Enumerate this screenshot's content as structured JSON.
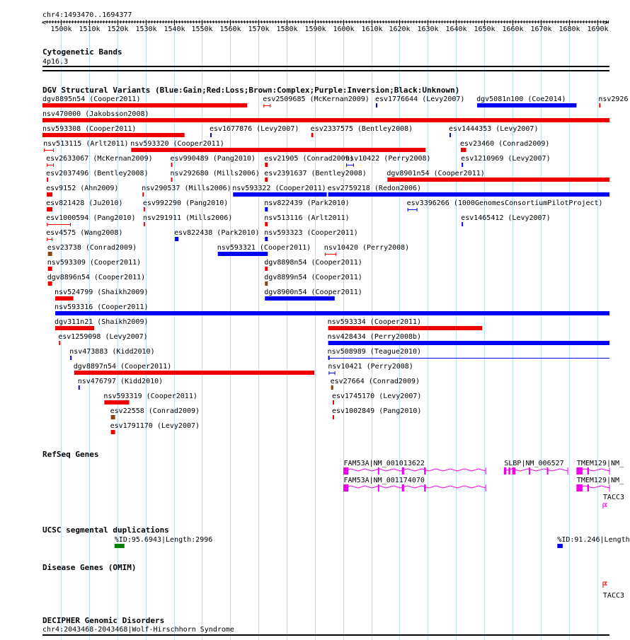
{
  "ruler": {
    "region": "chr4:1493470..1694377",
    "start": 1493470,
    "end": 1694377,
    "ticks": [
      "1500k",
      "1510k",
      "1520k",
      "1530k",
      "1540k",
      "1550k",
      "1560k",
      "1570k",
      "1580k",
      "1590k",
      "1600k",
      "1610k",
      "1620k",
      "1630k",
      "1640k",
      "1650k",
      "1660k",
      "1670k",
      "1680k",
      "1690k"
    ]
  },
  "colors": {
    "gain": "#0000ee",
    "loss": "#ee0000",
    "complex": "#8b4513",
    "gene": "#ee00ee",
    "segdup": "#008000",
    "grid": "#bfe2f2"
  },
  "cytoband": {
    "title": "Cytogenetic Bands",
    "band": "4p16.3"
  },
  "dgv": {
    "title": "DGV Structural Variants (Blue:Gain;Red:Loss;Brown:Complex;Purple:Inversion;Black:Unknown)",
    "variants": [
      {
        "label": "dgv8895n54 (Cooper2011)",
        "start": 1493470,
        "end": 1566000,
        "type": "loss",
        "row": 0
      },
      {
        "label": "esv2509685 (McKernan2009)",
        "start": 1571800,
        "end": 1574300,
        "type": "loss",
        "row": 0,
        "style": "span"
      },
      {
        "label": "esv1776644 (Levy2007)",
        "start": 1611600,
        "end": 1612100,
        "type": "gain",
        "row": 0
      },
      {
        "label": "dgv5081n100 (Coe2014)",
        "start": 1647500,
        "end": 1682700,
        "type": "gain",
        "row": 0
      },
      {
        "label": "nsv2926",
        "start": 1690700,
        "end": 1691200,
        "type": "loss",
        "row": 0
      },
      {
        "label": "nsv470000 (Jakobsson2008)",
        "start": 1493470,
        "end": 1694377,
        "type": "loss",
        "row": 1
      },
      {
        "label": "nsv593308 (Cooper2011)",
        "start": 1493470,
        "end": 1543800,
        "type": "loss",
        "row": 2
      },
      {
        "label": "esv1677876 (Levy2007)",
        "start": 1552900,
        "end": 1553400,
        "type": "gain",
        "row": 2
      },
      {
        "label": "esv2337575 (Bentley2008)",
        "start": 1588700,
        "end": 1589400,
        "type": "loss",
        "row": 2
      },
      {
        "label": "esv1444353 (Levy2007)",
        "start": 1637700,
        "end": 1638200,
        "type": "gain",
        "row": 2
      },
      {
        "label": "nsv513115 (Arlt2011)",
        "start": 1494000,
        "end": 1497500,
        "type": "loss",
        "row": 3,
        "style": "span"
      },
      {
        "label": "nsv593320 (Cooper2011)",
        "start": 1524900,
        "end": 1629200,
        "type": "loss",
        "row": 3
      },
      {
        "label": "esv23460 (Conrad2009)",
        "start": 1641700,
        "end": 1643600,
        "type": "loss",
        "row": 3
      },
      {
        "label": "esv2633067 (McKernan2009)",
        "start": 1495000,
        "end": 1497500,
        "type": "loss",
        "row": 4,
        "style": "span"
      },
      {
        "label": "esv990489 (Pang2010)",
        "start": 1539000,
        "end": 1539500,
        "type": "loss",
        "row": 4
      },
      {
        "label": "esv21905 (Conrad2009)",
        "start": 1572300,
        "end": 1573300,
        "type": "loss",
        "row": 4
      },
      {
        "label": "nsv10422 (Perry2008)",
        "start": 1601100,
        "end": 1603800,
        "type": "gain",
        "row": 4,
        "style": "span"
      },
      {
        "label": "esv1210969 (Levy2007)",
        "start": 1642000,
        "end": 1642500,
        "type": "gain",
        "row": 4
      },
      {
        "label": "esv2037496 (Bentley2008)",
        "start": 1495000,
        "end": 1495500,
        "type": "loss",
        "row": 5
      },
      {
        "label": "nsv292680 (Mills2006)",
        "start": 1539000,
        "end": 1539500,
        "type": "loss",
        "row": 5
      },
      {
        "label": "esv2391637 (Bentley2008)",
        "start": 1572300,
        "end": 1573300,
        "type": "loss",
        "row": 5
      },
      {
        "label": "dgv8901n54 (Cooper2011)",
        "start": 1615700,
        "end": 1694377,
        "type": "loss",
        "row": 5
      },
      {
        "label": "esv9152 (Ahn2009)",
        "start": 1495000,
        "end": 1497000,
        "type": "loss",
        "row": 6
      },
      {
        "label": "nsv290537 (Mills2006)",
        "start": 1528900,
        "end": 1529400,
        "type": "loss",
        "row": 6
      },
      {
        "label": "nsv593322 (Cooper2011)",
        "start": 1561000,
        "end": 1594200,
        "type": "gain",
        "row": 6
      },
      {
        "label": "esv2759218 (Redon2006)",
        "start": 1594700,
        "end": 1694377,
        "type": "gain",
        "row": 6
      },
      {
        "label": "esv821428 (Ju2010)",
        "start": 1495000,
        "end": 1497000,
        "type": "loss",
        "row": 7
      },
      {
        "label": "esv992290 (Pang2010)",
        "start": 1529300,
        "end": 1529800,
        "type": "loss",
        "row": 7
      },
      {
        "label": "nsv822439 (Park2010)",
        "start": 1572300,
        "end": 1573300,
        "type": "gain",
        "row": 7
      },
      {
        "label": "esv3396266 (1000GenomesConsortiumPilotProject)",
        "start": 1622800,
        "end": 1626300,
        "type": "gain",
        "row": 7,
        "style": "span"
      },
      {
        "label": "esv1000594 (Pang2010)",
        "start": 1495000,
        "end": 1503500,
        "type": "loss",
        "row": 8,
        "style": "span"
      },
      {
        "label": "nsv291911 (Mills2006)",
        "start": 1529300,
        "end": 1529800,
        "type": "loss",
        "row": 8
      },
      {
        "label": "nsv513116 (Arlt2011)",
        "start": 1572300,
        "end": 1573300,
        "type": "loss",
        "row": 8
      },
      {
        "label": "esv1465412 (Levy2007)",
        "start": 1642000,
        "end": 1642500,
        "type": "gain",
        "row": 8
      },
      {
        "label": "esv4575 (Wang2008)",
        "start": 1495000,
        "end": 1497000,
        "type": "loss",
        "row": 9,
        "style": "span"
      },
      {
        "label": "esv822438 (Park2010)",
        "start": 1540400,
        "end": 1541700,
        "type": "gain",
        "row": 9
      },
      {
        "label": "nsv593323 (Cooper2011)",
        "start": 1572300,
        "end": 1573300,
        "type": "gain",
        "row": 9
      },
      {
        "label": "esv23738 (Conrad2009)",
        "start": 1495400,
        "end": 1496900,
        "type": "complex",
        "row": 10
      },
      {
        "label": "nsv593321 (Cooper2011)",
        "start": 1555600,
        "end": 1573300,
        "type": "gain",
        "row": 10
      },
      {
        "label": "nsv10420 (Perry2008)",
        "start": 1593500,
        "end": 1597600,
        "type": "loss",
        "row": 10,
        "style": "span"
      },
      {
        "label": "nsv593309 (Cooper2011)",
        "start": 1495400,
        "end": 1496900,
        "type": "loss",
        "row": 11
      },
      {
        "label": "dgv8898n54 (Cooper2011)",
        "start": 1572300,
        "end": 1573300,
        "type": "loss",
        "row": 11
      },
      {
        "label": "dgv8896n54 (Cooper2011)",
        "start": 1495400,
        "end": 1496900,
        "type": "loss",
        "row": 12
      },
      {
        "label": "dgv8899n54 (Cooper2011)",
        "start": 1572300,
        "end": 1573300,
        "type": "complex",
        "row": 12
      },
      {
        "label": "nsv524799 (Shaikh2009)",
        "start": 1498000,
        "end": 1504400,
        "type": "loss",
        "row": 13
      },
      {
        "label": "dgv8900n54 (Cooper2011)",
        "start": 1572300,
        "end": 1597000,
        "type": "gain",
        "row": 13
      },
      {
        "label": "nsv593316 (Cooper2011)",
        "start": 1498000,
        "end": 1694377,
        "type": "gain",
        "row": 14
      },
      {
        "label": "dgv311n21 (Shaikh2009)",
        "start": 1498000,
        "end": 1511800,
        "type": "loss",
        "row": 15
      },
      {
        "label": "nsv593334 (Cooper2011)",
        "start": 1594700,
        "end": 1649300,
        "type": "loss",
        "row": 15
      },
      {
        "label": "esv1259098 (Levy2007)",
        "start": 1499300,
        "end": 1499800,
        "type": "loss",
        "row": 16
      },
      {
        "label": "nsv428434 (Perry2008b)",
        "start": 1594700,
        "end": 1694377,
        "type": "gain",
        "row": 16
      },
      {
        "label": "nsv473883 (Kidd2010)",
        "start": 1503300,
        "end": 1503800,
        "type": "gain",
        "row": 17
      },
      {
        "label": "nsv508989 (Teague2010)",
        "start": 1594700,
        "end": 1694377,
        "type": "gain",
        "row": 17,
        "style": "thin"
      },
      {
        "label": "dgv8897n54 (Cooper2011)",
        "start": 1504700,
        "end": 1589800,
        "type": "loss",
        "row": 18
      },
      {
        "label": "nsv10421 (Perry2008)",
        "start": 1594900,
        "end": 1597200,
        "type": "gain",
        "row": 18,
        "style": "span"
      },
      {
        "label": "nsv476797 (Kidd2010)",
        "start": 1506200,
        "end": 1506700,
        "type": "gain",
        "row": 19
      },
      {
        "label": "esv27664 (Conrad2009)",
        "start": 1595700,
        "end": 1596500,
        "type": "complex",
        "row": 19
      },
      {
        "label": "nsv593319 (Cooper2011)",
        "start": 1515400,
        "end": 1524200,
        "type": "loss",
        "row": 20
      },
      {
        "label": "esv1745170 (Levy2007)",
        "start": 1596300,
        "end": 1596800,
        "type": "loss",
        "row": 20
      },
      {
        "label": "esv22558 (Conrad2009)",
        "start": 1517700,
        "end": 1519200,
        "type": "complex",
        "row": 21
      },
      {
        "label": "esv1002849 (Pang2010)",
        "start": 1596300,
        "end": 1596800,
        "type": "loss",
        "row": 21
      },
      {
        "label": "esv1791170 (Levy2007)",
        "start": 1517700,
        "end": 1519200,
        "type": "loss",
        "row": 22
      }
    ]
  },
  "refseq": {
    "title": "RefSeq Genes",
    "genes": [
      {
        "label": "FAM53A|NM_001013622",
        "start": 1600200,
        "end": 1650500,
        "row": 0,
        "exons": [
          [
            1600200,
            1601900
          ],
          [
            1612300,
            1612800
          ],
          [
            1620800,
            1621600
          ],
          [
            1628700,
            1629300
          ]
        ]
      },
      {
        "label": "SLBP|NM_006527",
        "start": 1657100,
        "end": 1679600,
        "row": 0,
        "exons": [
          [
            1657100,
            1657800
          ],
          [
            1658600,
            1659200
          ],
          [
            1659900,
            1661100
          ],
          [
            1665800,
            1666300
          ],
          [
            1672200,
            1672600
          ]
        ]
      },
      {
        "label": "TMEM129|NM_",
        "start": 1682800,
        "end": 1694377,
        "row": 0,
        "exons": [
          [
            1682800,
            1684800
          ],
          [
            1686500,
            1687100
          ]
        ]
      },
      {
        "label": "FAM53A|NM_001174070",
        "start": 1600200,
        "end": 1650500,
        "row": 1,
        "exons": [
          [
            1600200,
            1601900
          ],
          [
            1612300,
            1612800
          ],
          [
            1620800,
            1621600
          ],
          [
            1628700,
            1629300
          ]
        ]
      },
      {
        "label": "TMEM129|NM_",
        "start": 1682800,
        "end": 1694377,
        "row": 1,
        "exons": [
          [
            1682800,
            1684800
          ],
          [
            1686500,
            1687100
          ]
        ]
      },
      {
        "label": "TACC3",
        "start": 1692100,
        "end": 1694377,
        "row": 2,
        "exons": []
      }
    ]
  },
  "segdup": {
    "title": "UCSC segmental duplications",
    "items": [
      {
        "label": "%ID:95.6943|Length:2996",
        "start": 1519000,
        "end": 1522500,
        "color": "segdup"
      },
      {
        "label": "%ID:91.246|Length:",
        "start": 1675900,
        "end": 1677800,
        "color": "gain"
      }
    ]
  },
  "omim": {
    "title": "Disease Genes (OMIM)",
    "genes": [
      {
        "label": "TACC3",
        "start": 1692100,
        "end": 1694377
      }
    ]
  },
  "decipher": {
    "title": "DECIPHER Genomic Disorders",
    "line": "chr4:2043468-2043468|Wolf-Hirschhorn Syndrome"
  }
}
